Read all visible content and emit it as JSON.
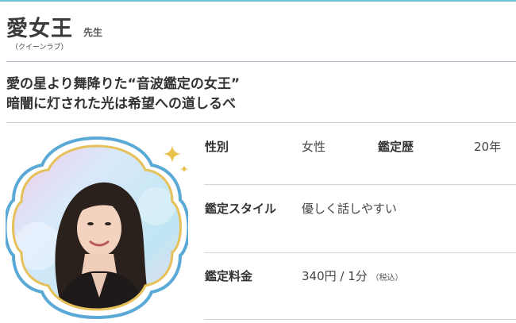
{
  "profile": {
    "name": "愛女王",
    "honorific": "先生",
    "reading": "（クイーンラブ）"
  },
  "catchphrase": {
    "line1": "愛の星より舞降りた“音波鑑定の女王”",
    "line2": "暗闇に灯された光は希望への道しるべ"
  },
  "details": {
    "gender_label": "性別",
    "gender_value": "女性",
    "experience_label": "鑑定歴",
    "experience_value": "20年",
    "style_label": "鑑定スタイル",
    "style_value": "優しく話しやすい",
    "fee_label": "鑑定料金",
    "fee_value": "340円 / 1分",
    "fee_tax": "（税込）"
  },
  "colors": {
    "accent_teal": "#6fc2d3",
    "frame_blue": "#5aa9d6",
    "frame_gold": "#e6c15a",
    "sparkle_gold": "#e8c04a"
  },
  "icons": {
    "sparkle": "four-point-star-icon"
  }
}
